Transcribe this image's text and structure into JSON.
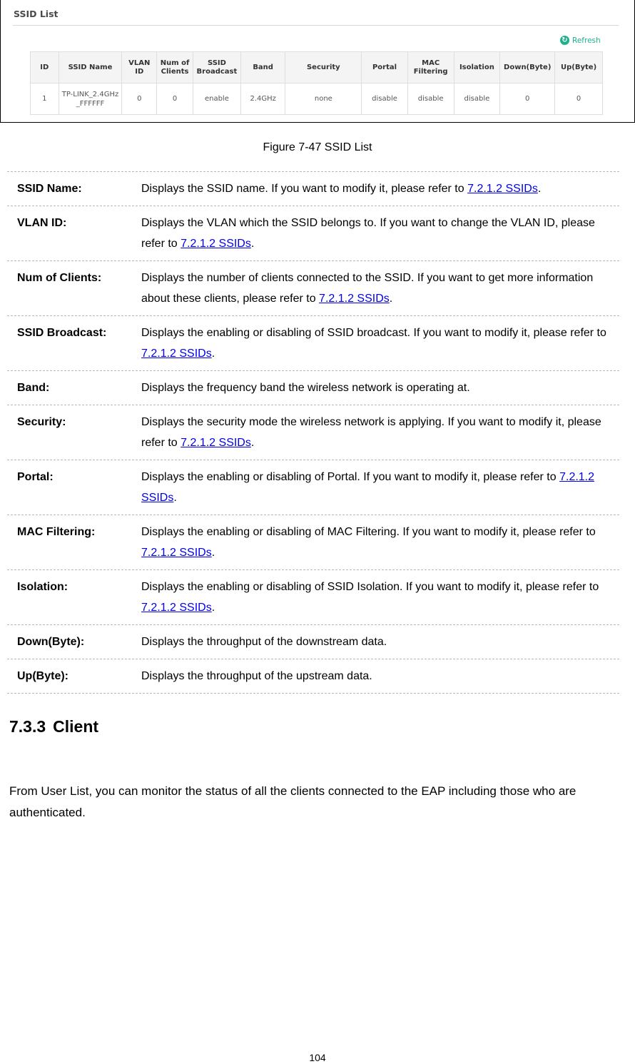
{
  "figure": {
    "panel_title": "SSID List",
    "refresh_label": "Refresh",
    "refresh_icon": "refresh-icon",
    "accent_color": "#20b08a",
    "table": {
      "headers": [
        "ID",
        "SSID Name",
        "VLAN ID",
        "Num of Clients",
        "SSID Broadcast",
        "Band",
        "Security",
        "Portal",
        "MAC Filtering",
        "Isolation",
        "Down(Byte)",
        "Up(Byte)"
      ],
      "rows": [
        [
          "1",
          "TP-LINK_2.4GHz_FFFFFF",
          "0",
          "0",
          "enable",
          "2.4GHz",
          "none",
          "disable",
          "disable",
          "disable",
          "0",
          "0"
        ]
      ]
    }
  },
  "caption": "Figure 7-47 SSID List",
  "definitions": [
    {
      "term": "SSID Name:",
      "text": "Displays the SSID name. If you want to modify it, please refer to ",
      "link": "7.2.1.2 SSIDs",
      "after": "."
    },
    {
      "term": "VLAN ID:",
      "text": "Displays the VLAN which the SSID belongs to. If you want to change the VLAN ID, please refer to ",
      "link": "7.2.1.2 SSIDs",
      "after": "."
    },
    {
      "term": "Num of Clients:",
      "text": "Displays the number of clients connected to the SSID. If you want to get more information about these clients, please refer to ",
      "link": "7.2.1.2 SSIDs",
      "after": "."
    },
    {
      "term": "SSID Broadcast:",
      "text": "Displays the enabling or disabling of SSID broadcast. If you want to modify it, please refer to ",
      "link": "7.2.1.2 SSIDs",
      "after": "."
    },
    {
      "term": "Band:",
      "text": "Displays the frequency band the wireless network is operating at.",
      "link": "",
      "after": ""
    },
    {
      "term": "Security:",
      "text": "Displays the security mode the wireless network is applying. If you want to modify it, please refer to ",
      "link": "7.2.1.2 SSIDs",
      "after": "."
    },
    {
      "term": "Portal:",
      "text": "Displays the enabling or disabling of Portal. If you want to modify it, please refer to ",
      "link": "7.2.1.2 SSIDs",
      "after": "."
    },
    {
      "term": "MAC Filtering:",
      "text": "Displays the enabling or disabling of MAC Filtering. If you want to modify it, please refer to ",
      "link": "7.2.1.2 SSIDs",
      "after": "."
    },
    {
      "term": "Isolation:",
      "text": "Displays the enabling or disabling of SSID Isolation. If you want to modify it, please refer to ",
      "link": "7.2.1.2 SSIDs",
      "after": "."
    },
    {
      "term": "Down(Byte):",
      "text": "Displays the throughput of the downstream data.",
      "link": "",
      "after": ""
    },
    {
      "term": "Up(Byte):",
      "text": "Displays the throughput of the upstream data.",
      "link": "",
      "after": ""
    }
  ],
  "section": {
    "number": "7.3.3",
    "title": "Client",
    "paragraph": "From User List, you can monitor the status of all the clients connected to the EAP including those who are authenticated."
  },
  "page_number": "104"
}
